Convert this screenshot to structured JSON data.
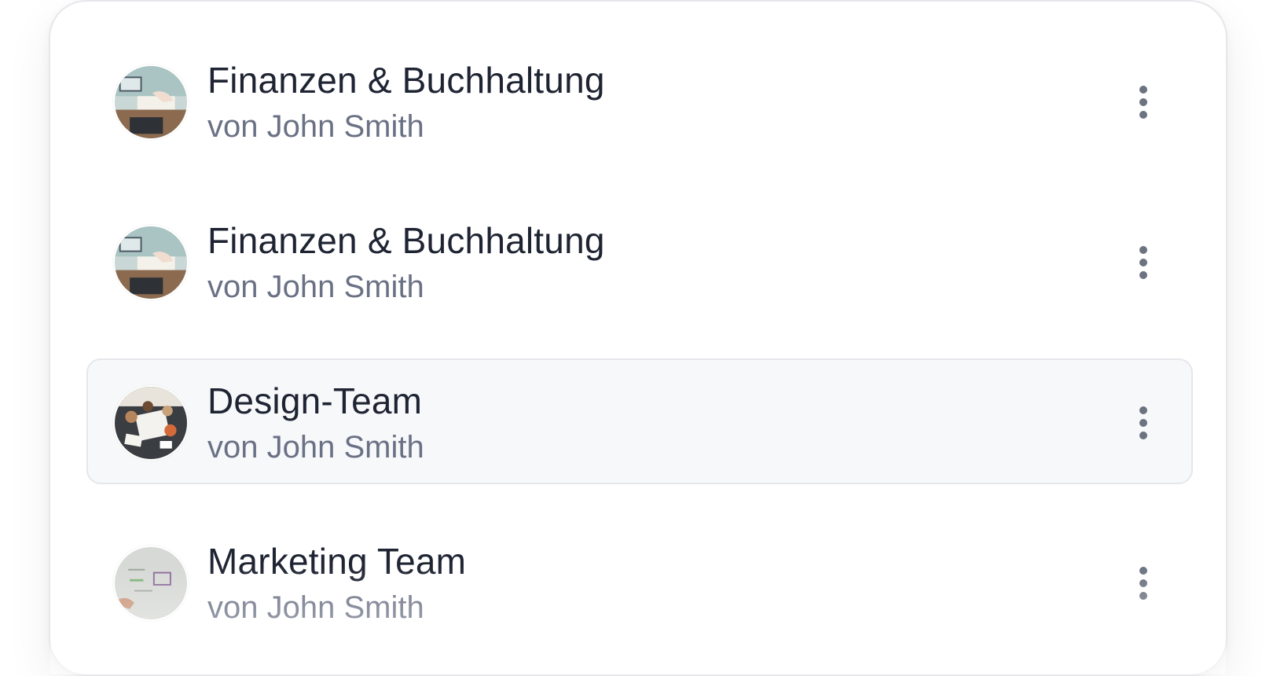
{
  "groups": [
    {
      "title": "Finanzen & Buchhaltung",
      "subtitle": "von John Smith",
      "avatar_icon": "finance-photo",
      "selected": false
    },
    {
      "title": "Finanzen & Buchhaltung",
      "subtitle": "von John Smith",
      "avatar_icon": "finance-photo",
      "selected": false
    },
    {
      "title": "Design-Team",
      "subtitle": "von John Smith",
      "avatar_icon": "design-team-photo",
      "selected": true
    },
    {
      "title": "Marketing Team",
      "subtitle": "von John Smith",
      "avatar_icon": "marketing-whiteboard-photo",
      "selected": false
    }
  ],
  "colors": {
    "title": "#1f2433",
    "subtitle": "#6b7185",
    "selected_bg": "#f7f8fa",
    "border": "#e5e7eb",
    "menu_dots": "#6b7280"
  }
}
